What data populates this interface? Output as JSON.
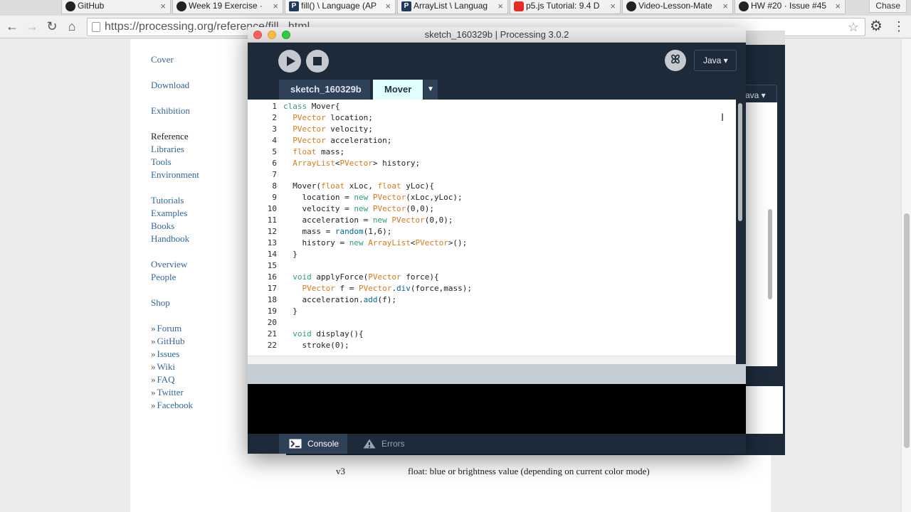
{
  "browser": {
    "tabs": [
      {
        "label": "GitHub",
        "icon": "github-icon"
      },
      {
        "label": "Week 19 Exercise · ",
        "icon": "github-icon"
      },
      {
        "label": "fill() \\ Language (AP",
        "icon": "processing-icon"
      },
      {
        "label": "ArrayList \\ Languag",
        "icon": "processing-icon"
      },
      {
        "label": "p5.js Tutorial: 9.4 D",
        "icon": "youtube-icon"
      },
      {
        "label": "Video-Lesson-Mate",
        "icon": "github-icon"
      },
      {
        "label": "HW #20 · Issue #45",
        "icon": "github-icon"
      }
    ],
    "profile": "Chase",
    "url": "https://processing.org/reference/fill_.html",
    "icons": {
      "back": "←",
      "forward": "→",
      "reload": "↻",
      "home": "⌂",
      "star": "☆",
      "settings": "⚙",
      "menu": "⋮"
    }
  },
  "site": {
    "nav": [
      {
        "label": "Cover"
      },
      {
        "label": ""
      },
      {
        "label": "Download"
      },
      {
        "label": ""
      },
      {
        "label": "Exhibition"
      },
      {
        "label": ""
      },
      {
        "label": "Reference",
        "current": true
      },
      {
        "label": "Libraries"
      },
      {
        "label": "Tools"
      },
      {
        "label": "Environment"
      },
      {
        "label": ""
      },
      {
        "label": "Tutorials"
      },
      {
        "label": "Examples"
      },
      {
        "label": "Books"
      },
      {
        "label": "Handbook"
      },
      {
        "label": ""
      },
      {
        "label": "Overview"
      },
      {
        "label": "People"
      },
      {
        "label": ""
      },
      {
        "label": "Shop"
      },
      {
        "label": ""
      },
      {
        "label": "Forum",
        "external": true
      },
      {
        "label": "GitHub",
        "external": true
      },
      {
        "label": "Issues",
        "external": true
      },
      {
        "label": "Wiki",
        "external": true
      },
      {
        "label": "FAQ",
        "external": true
      },
      {
        "label": "Twitter",
        "external": true
      },
      {
        "label": "Facebook",
        "external": true
      }
    ],
    "external_marker": "»",
    "param_name": "v3",
    "param_desc": "float: blue or brightness value (depending on current color mode)"
  },
  "back_window": {
    "mode": "ava ▾"
  },
  "ide": {
    "title": "sketch_160329b | Processing 3.0.2",
    "mode": "Java ▾",
    "debug_icon": "ꕤ",
    "tabs": [
      {
        "label": "sketch_160329b"
      },
      {
        "label": "Mover",
        "active": true
      }
    ],
    "tab_menu": "▼",
    "code": [
      [
        [
          "class",
          "kb"
        ],
        [
          " Mover{",
          ""
        ]
      ],
      [
        [
          "  ",
          ""
        ],
        [
          "PVector",
          "kw"
        ],
        [
          " location;",
          ""
        ]
      ],
      [
        [
          "  ",
          ""
        ],
        [
          "PVector",
          "kw"
        ],
        [
          " velocity;",
          ""
        ]
      ],
      [
        [
          "  ",
          ""
        ],
        [
          "PVector",
          "kw"
        ],
        [
          " acceleration;",
          ""
        ]
      ],
      [
        [
          "  ",
          ""
        ],
        [
          "float",
          "kw"
        ],
        [
          " mass;",
          ""
        ]
      ],
      [
        [
          "  ",
          ""
        ],
        [
          "ArrayList",
          "kw"
        ],
        [
          "<",
          ""
        ],
        [
          "PVector",
          "kw"
        ],
        [
          "> history;",
          ""
        ]
      ],
      [
        [
          "",
          ""
        ]
      ],
      [
        [
          "  Mover(",
          ""
        ],
        [
          "float",
          "kw"
        ],
        [
          " xLoc, ",
          ""
        ],
        [
          "float",
          "kw"
        ],
        [
          " yLoc){",
          ""
        ]
      ],
      [
        [
          "    location = ",
          ""
        ],
        [
          "new",
          "kb"
        ],
        [
          " ",
          ""
        ],
        [
          "PVector",
          "kw"
        ],
        [
          "(xLoc,yLoc);",
          ""
        ]
      ],
      [
        [
          "    velocity = ",
          ""
        ],
        [
          "new",
          "kb"
        ],
        [
          " ",
          ""
        ],
        [
          "PVector",
          "kw"
        ],
        [
          "(0,0);",
          ""
        ]
      ],
      [
        [
          "    acceleration = ",
          ""
        ],
        [
          "new",
          "kb"
        ],
        [
          " ",
          ""
        ],
        [
          "PVector",
          "kw"
        ],
        [
          "(0,0);",
          ""
        ]
      ],
      [
        [
          "    mass = ",
          ""
        ],
        [
          "random",
          "fn"
        ],
        [
          "(1,6);",
          ""
        ]
      ],
      [
        [
          "    history = ",
          ""
        ],
        [
          "new",
          "kb"
        ],
        [
          " ",
          ""
        ],
        [
          "ArrayList",
          "kw"
        ],
        [
          "<",
          ""
        ],
        [
          "PVector",
          "kw"
        ],
        [
          ">();",
          ""
        ]
      ],
      [
        [
          "  }",
          ""
        ]
      ],
      [
        [
          "",
          ""
        ]
      ],
      [
        [
          "  ",
          ""
        ],
        [
          "void",
          "kb"
        ],
        [
          " applyForce(",
          ""
        ],
        [
          "PVector",
          "kw"
        ],
        [
          " force){",
          ""
        ]
      ],
      [
        [
          "    ",
          ""
        ],
        [
          "PVector",
          "kw"
        ],
        [
          " f = ",
          ""
        ],
        [
          "PVector",
          "kw"
        ],
        [
          ".",
          ""
        ],
        [
          "div",
          "fn"
        ],
        [
          "(force,mass);",
          ""
        ]
      ],
      [
        [
          "    acceleration.",
          ""
        ],
        [
          "add",
          "fn"
        ],
        [
          "(f);",
          ""
        ]
      ],
      [
        [
          "  }",
          ""
        ]
      ],
      [
        [
          "",
          ""
        ]
      ],
      [
        [
          "  ",
          ""
        ],
        [
          "void",
          "kb"
        ],
        [
          " display(){",
          ""
        ]
      ],
      [
        [
          "    stroke(0);",
          ""
        ]
      ]
    ],
    "footer": {
      "console": "Console",
      "errors": "Errors"
    }
  },
  "colors": {
    "accent": "#336699",
    "ide_bg": "#1c2a3a",
    "keyword": "#d97a1a",
    "builtin": "#33997e",
    "function": "#006699"
  }
}
